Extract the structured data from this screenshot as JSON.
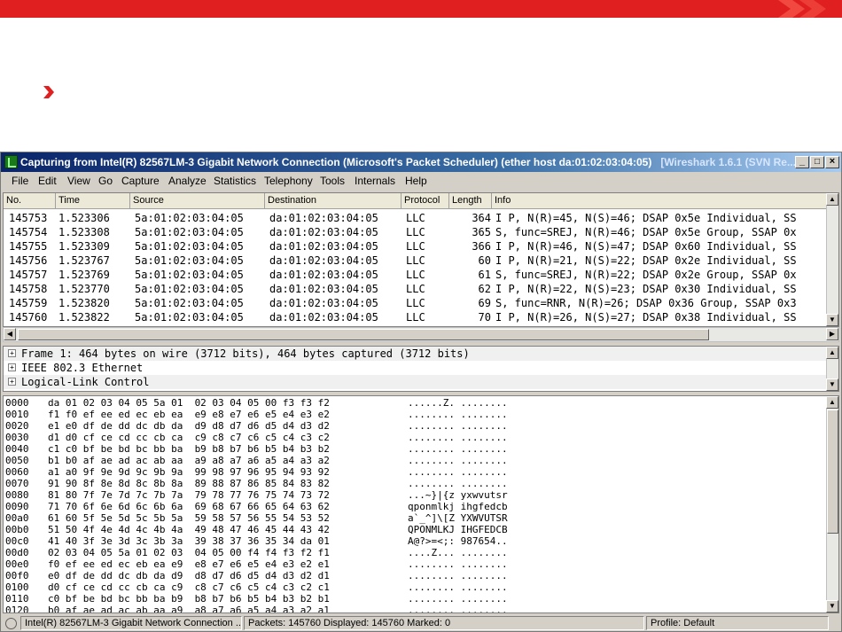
{
  "window": {
    "title": "Capturing from Intel(R) 82567LM-3 Gigabit Network Connection (Microsoft's Packet Scheduler)  (ether host da:01:02:03:04:05)",
    "app_name": "[Wireshark 1.6.1  (SVN Re...",
    "minimize": "_",
    "maximize": "□",
    "close": "×"
  },
  "menu": [
    "File",
    "Edit",
    "View",
    "Go",
    "Capture",
    "Analyze",
    "Statistics",
    "Telephony",
    "Tools",
    "Internals",
    "Help"
  ],
  "packet_list": {
    "columns": [
      "No.",
      "Time",
      "Source",
      "Destination",
      "Protocol",
      "Length",
      "Info"
    ],
    "rows": [
      {
        "no": "145753",
        "time": "1.523306",
        "src": "5a:01:02:03:04:05",
        "dst": "da:01:02:03:04:05",
        "proto": "LLC",
        "len": "364",
        "info": "I P, N(R)=45, N(S)=46; DSAP 0x5e Individual, SS"
      },
      {
        "no": "145754",
        "time": "1.523308",
        "src": "5a:01:02:03:04:05",
        "dst": "da:01:02:03:04:05",
        "proto": "LLC",
        "len": "365",
        "info": "S, func=SREJ, N(R)=46; DSAP 0x5e Group, SSAP 0x"
      },
      {
        "no": "145755",
        "time": "1.523309",
        "src": "5a:01:02:03:04:05",
        "dst": "da:01:02:03:04:05",
        "proto": "LLC",
        "len": "366",
        "info": "I P, N(R)=46, N(S)=47; DSAP 0x60 Individual, SS"
      },
      {
        "no": "145756",
        "time": "1.523767",
        "src": "5a:01:02:03:04:05",
        "dst": "da:01:02:03:04:05",
        "proto": "LLC",
        "len": "60",
        "info": "I P, N(R)=21, N(S)=22; DSAP 0x2e Individual, SS"
      },
      {
        "no": "145757",
        "time": "1.523769",
        "src": "5a:01:02:03:04:05",
        "dst": "da:01:02:03:04:05",
        "proto": "LLC",
        "len": "61",
        "info": "S, func=SREJ, N(R)=22; DSAP 0x2e Group, SSAP 0x"
      },
      {
        "no": "145758",
        "time": "1.523770",
        "src": "5a:01:02:03:04:05",
        "dst": "da:01:02:03:04:05",
        "proto": "LLC",
        "len": "62",
        "info": "I P, N(R)=22, N(S)=23; DSAP 0x30 Individual, SS"
      },
      {
        "no": "145759",
        "time": "1.523820",
        "src": "5a:01:02:03:04:05",
        "dst": "da:01:02:03:04:05",
        "proto": "LLC",
        "len": "69",
        "info": "S, func=RNR, N(R)=26; DSAP 0x36 Group, SSAP 0x3"
      },
      {
        "no": "145760",
        "time": "1.523822",
        "src": "5a:01:02:03:04:05",
        "dst": "da:01:02:03:04:05",
        "proto": "LLC",
        "len": "70",
        "info": "I P, N(R)=26, N(S)=27; DSAP 0x38 Individual, SS"
      }
    ]
  },
  "details": [
    "Frame 1: 464 bytes on wire (3712 bits), 464 bytes captured (3712 bits)",
    "IEEE 802.3 Ethernet",
    "Logical-Link Control"
  ],
  "bytes": [
    {
      "off": "0000",
      "hex": "da 01 02 03 04 05 5a 01  02 03 04 05 00 f3 f3 f2",
      "ascii": "......Z. ........"
    },
    {
      "off": "0010",
      "hex": "f1 f0 ef ee ed ec eb ea  e9 e8 e7 e6 e5 e4 e3 e2",
      "ascii": "........ ........"
    },
    {
      "off": "0020",
      "hex": "e1 e0 df de dd dc db da  d9 d8 d7 d6 d5 d4 d3 d2",
      "ascii": "........ ........"
    },
    {
      "off": "0030",
      "hex": "d1 d0 cf ce cd cc cb ca  c9 c8 c7 c6 c5 c4 c3 c2",
      "ascii": "........ ........"
    },
    {
      "off": "0040",
      "hex": "c1 c0 bf be bd bc bb ba  b9 b8 b7 b6 b5 b4 b3 b2",
      "ascii": "........ ........"
    },
    {
      "off": "0050",
      "hex": "b1 b0 af ae ad ac ab aa  a9 a8 a7 a6 a5 a4 a3 a2",
      "ascii": "........ ........"
    },
    {
      "off": "0060",
      "hex": "a1 a0 9f 9e 9d 9c 9b 9a  99 98 97 96 95 94 93 92",
      "ascii": "........ ........"
    },
    {
      "off": "0070",
      "hex": "91 90 8f 8e 8d 8c 8b 8a  89 88 87 86 85 84 83 82",
      "ascii": "........ ........"
    },
    {
      "off": "0080",
      "hex": "81 80 7f 7e 7d 7c 7b 7a  79 78 77 76 75 74 73 72",
      "ascii": "...~}|{z yxwvutsr"
    },
    {
      "off": "0090",
      "hex": "71 70 6f 6e 6d 6c 6b 6a  69 68 67 66 65 64 63 62",
      "ascii": "qponmlkj ihgfedcb"
    },
    {
      "off": "00a0",
      "hex": "61 60 5f 5e 5d 5c 5b 5a  59 58 57 56 55 54 53 52",
      "ascii": "a`_^]\\[Z YXWVUTSR"
    },
    {
      "off": "00b0",
      "hex": "51 50 4f 4e 4d 4c 4b 4a  49 48 47 46 45 44 43 42",
      "ascii": "QPONMLKJ IHGFEDCB"
    },
    {
      "off": "00c0",
      "hex": "41 40 3f 3e 3d 3c 3b 3a  39 38 37 36 35 34 da 01",
      "ascii": "A@?>=<;: 987654.."
    },
    {
      "off": "00d0",
      "hex": "02 03 04 05 5a 01 02 03  04 05 00 f4 f4 f3 f2 f1",
      "ascii": "....Z... ........"
    },
    {
      "off": "00e0",
      "hex": "f0 ef ee ed ec eb ea e9  e8 e7 e6 e5 e4 e3 e2 e1",
      "ascii": "........ ........"
    },
    {
      "off": "00f0",
      "hex": "e0 df de dd dc db da d9  d8 d7 d6 d5 d4 d3 d2 d1",
      "ascii": "........ ........"
    },
    {
      "off": "0100",
      "hex": "d0 cf ce cd cc cb ca c9  c8 c7 c6 c5 c4 c3 c2 c1",
      "ascii": "........ ........"
    },
    {
      "off": "0110",
      "hex": "c0 bf be bd bc bb ba b9  b8 b7 b6 b5 b4 b3 b2 b1",
      "ascii": "........ ........"
    },
    {
      "off": "0120",
      "hex": "b0 af ae ad ac ab aa a9  a8 a7 a6 a5 a4 a3 a2 a1",
      "ascii": "........ ........"
    }
  ],
  "status": {
    "interface": "Intel(R) 82567LM-3 Gigabit Network Connection ...",
    "packets": "Packets: 145760 Displayed: 145760 Marked: 0",
    "profile": "Profile: Default"
  },
  "colors": {
    "slide_bar": "#e02020",
    "bullet": "#e02020",
    "title_bar_start": "#0a246a",
    "title_bar_end": "#a6caf0"
  }
}
